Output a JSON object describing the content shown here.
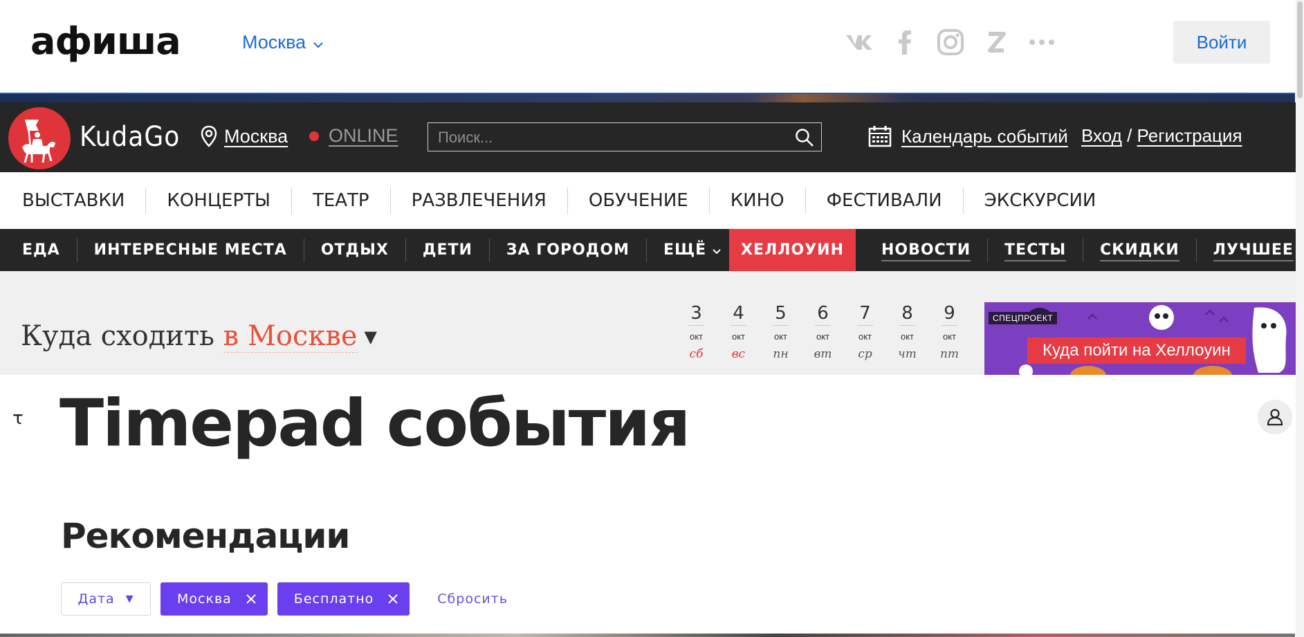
{
  "afisha": {
    "logo": "афиша",
    "city": "Москва",
    "socials": [
      "vk-icon",
      "facebook-icon",
      "instagram-icon",
      "zen-icon",
      "more-icon"
    ],
    "login_label": "Войти"
  },
  "kudago": {
    "wordmark": "KudaGo",
    "city": "Москва",
    "online": "ONLINE",
    "search_placeholder": "Поиск...",
    "calendar": "Календарь событий",
    "login": "Вход",
    "separator": "/",
    "register": "Регистрация"
  },
  "nav_primary": [
    "ВЫСТАВКИ",
    "КОНЦЕРТЫ",
    "ТЕАТР",
    "РАЗВЛЕЧЕНИЯ",
    "ОБУЧЕНИЕ",
    "КИНО",
    "ФЕСТИВАЛИ",
    "ЭКСКУРСИИ"
  ],
  "nav_secondary": {
    "left": [
      "ЕДА",
      "ИНТЕРЕСНЫЕ МЕСТА",
      "ОТДЫХ",
      "ДЕТИ",
      "ЗА ГОРОДОМ",
      "ЕЩЁ"
    ],
    "highlight": "ХЕЛЛОУИН",
    "right": [
      "НОВОСТИ",
      "ТЕСТЫ",
      "СКИДКИ",
      "ЛУЧШЕЕ"
    ]
  },
  "where_to_go": {
    "prefix": "Куда сходить",
    "city": "в Москве",
    "arrow": "▼",
    "days": [
      {
        "num": "3",
        "month": "окт",
        "weekday": "сб",
        "weekend": true
      },
      {
        "num": "4",
        "month": "окт",
        "weekday": "вс",
        "weekend": true
      },
      {
        "num": "5",
        "month": "окт",
        "weekday": "пн",
        "weekend": false
      },
      {
        "num": "6",
        "month": "окт",
        "weekday": "вт",
        "weekend": false
      },
      {
        "num": "7",
        "month": "окт",
        "weekday": "ср",
        "weekend": false
      },
      {
        "num": "8",
        "month": "окт",
        "weekday": "чт",
        "weekend": false
      },
      {
        "num": "9",
        "month": "окт",
        "weekday": "пт",
        "weekend": false
      }
    ],
    "promo": {
      "tag": "СПЕЦПРОЕКТ",
      "text": "Куда пойти на Хеллоуин"
    }
  },
  "timepad": {
    "logo": "τ",
    "title": "Timepad события",
    "recommendations": "Рекомендации",
    "filters": {
      "date_label": "Дата",
      "date_arrow": "▼",
      "chips": [
        "Москва",
        "Бесплатно"
      ],
      "reset": "Сбросить"
    }
  },
  "colors": {
    "kudago_dark": "#262626",
    "kudago_red": "#e0343b",
    "afisha_blue": "#1a6bd6",
    "city_orange": "#e8503a",
    "timepad_purple": "#6a3fef"
  }
}
